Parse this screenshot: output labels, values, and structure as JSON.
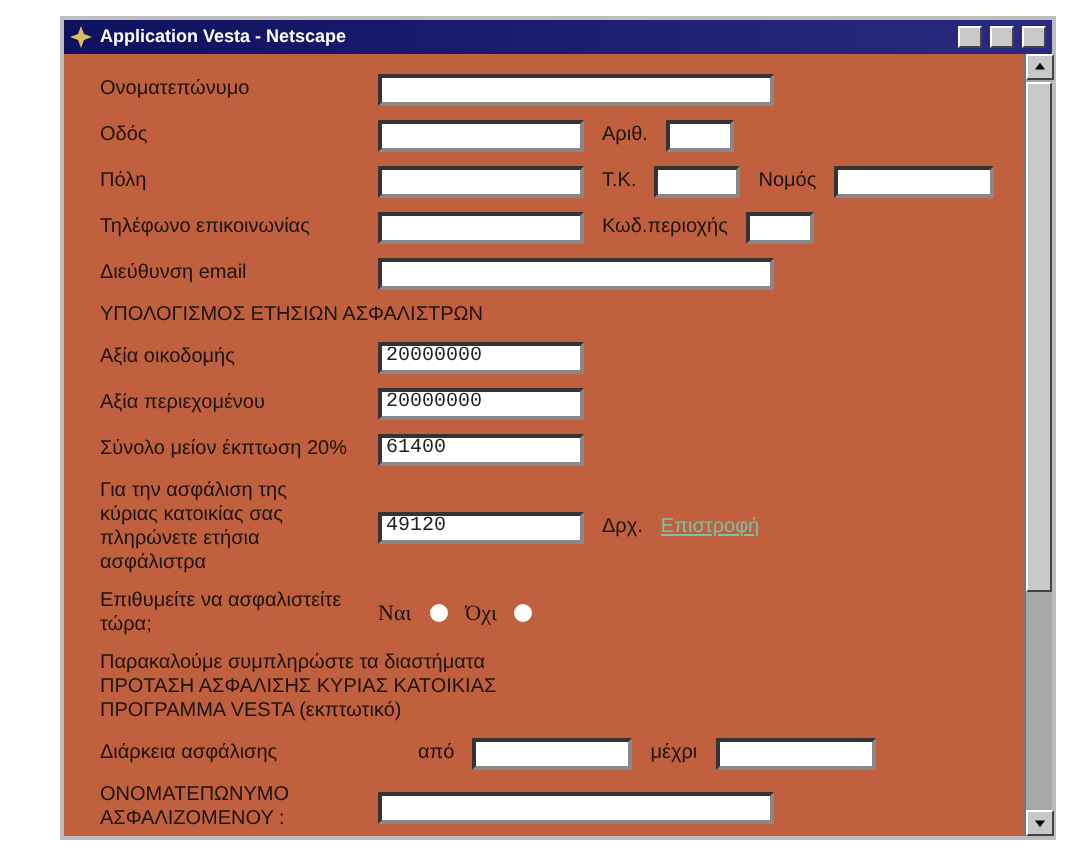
{
  "window": {
    "title": "Application Vesta - Netscape"
  },
  "rows": [
    {
      "kind": "fields",
      "label": [
        "Ονοματεπώνυμο"
      ],
      "parts": [
        {
          "kind": "input"
        }
      ]
    },
    {
      "kind": "fields",
      "label": [
        "Οδός"
      ],
      "parts": [
        {
          "kind": "input"
        },
        {
          "kind": "text",
          "text": "Αριθ."
        },
        {
          "kind": "input"
        }
      ]
    },
    {
      "kind": "fields",
      "label": [
        "Πόλη"
      ],
      "parts": [
        {
          "kind": "input"
        },
        {
          "kind": "text",
          "text": "Τ.Κ."
        },
        {
          "kind": "input"
        },
        {
          "kind": "text",
          "text": "Νομός"
        },
        {
          "kind": "input"
        }
      ]
    },
    {
      "kind": "fields",
      "label": [
        "Τηλέφωνο επικοινωνίας"
      ],
      "parts": [
        {
          "kind": "input"
        },
        {
          "kind": "text",
          "text": "Κωδ.περιοχής"
        },
        {
          "kind": "input"
        }
      ]
    },
    {
      "kind": "fields",
      "label": [
        "Διεύθυνση email"
      ],
      "parts": [
        {
          "kind": "input"
        }
      ]
    },
    {
      "kind": "heading",
      "lines": [
        "ΥΠΟΛΟΓΙΣΜΟΣ ΕΤΗΣΙΩΝ ΑΣΦΑΛΙΣΤΡΩΝ"
      ]
    },
    {
      "kind": "fields",
      "label": [
        "Αξία οικοδομής"
      ],
      "parts": [
        {
          "kind": "input",
          "value": "20000000"
        }
      ]
    },
    {
      "kind": "fields",
      "label": [
        "Αξία περιεχομένου"
      ],
      "parts": [
        {
          "kind": "input",
          "value": "20000000"
        }
      ]
    },
    {
      "kind": "fields",
      "label": [
        "Σύνολο μείον έκπτωση 20%"
      ],
      "parts": [
        {
          "kind": "input",
          "value": "61400"
        }
      ]
    },
    {
      "kind": "fields",
      "label": [
        "Για την ασφάλιση της",
        "κύριας κατοικίας σας",
        "πληρώνετε ετήσια",
        "ασφάλιστρα"
      ],
      "parts": [
        {
          "kind": "input",
          "value": "49120"
        },
        {
          "kind": "text",
          "text": "Δρχ."
        },
        {
          "kind": "link",
          "text": "Επιστροφή"
        }
      ]
    },
    {
      "kind": "fields",
      "label": [
        "Επιθυμείτε να ασφαλιστείτε",
        "τώρα;"
      ],
      "parts": [
        {
          "kind": "radio",
          "text": "Ναι",
          "checked": false
        },
        {
          "kind": "radio",
          "text": "Όχι",
          "checked": false
        }
      ]
    },
    {
      "kind": "heading",
      "lines": [
        "Παρακαλούμε συμπληρώστε τα διαστήματα",
        "ΠΡΟΤΑΣΗ ΑΣΦΑΛΙΣΗΣ ΚΥΡΙΑΣ ΚΑΤΟΙΚΙΑΣ",
        "ΠΡΟΓΡΑΜΜΑ VESTA (εκπτωτικό)"
      ]
    },
    {
      "kind": "fields",
      "label": [
        "Διάρκεια ασφάλισης"
      ],
      "parts": [
        {
          "kind": "text",
          "text": "από"
        },
        {
          "kind": "input"
        },
        {
          "kind": "text",
          "text": "μέχρι"
        },
        {
          "kind": "input"
        }
      ]
    },
    {
      "kind": "fields",
      "label": [
        "ΟΝΟΜΑΤΕΠΩΝΥΜΟ",
        "ΑΣΦΑΛΙΖΟΜΕΝΟΥ :"
      ],
      "parts": [
        {
          "kind": "input"
        }
      ]
    }
  ]
}
